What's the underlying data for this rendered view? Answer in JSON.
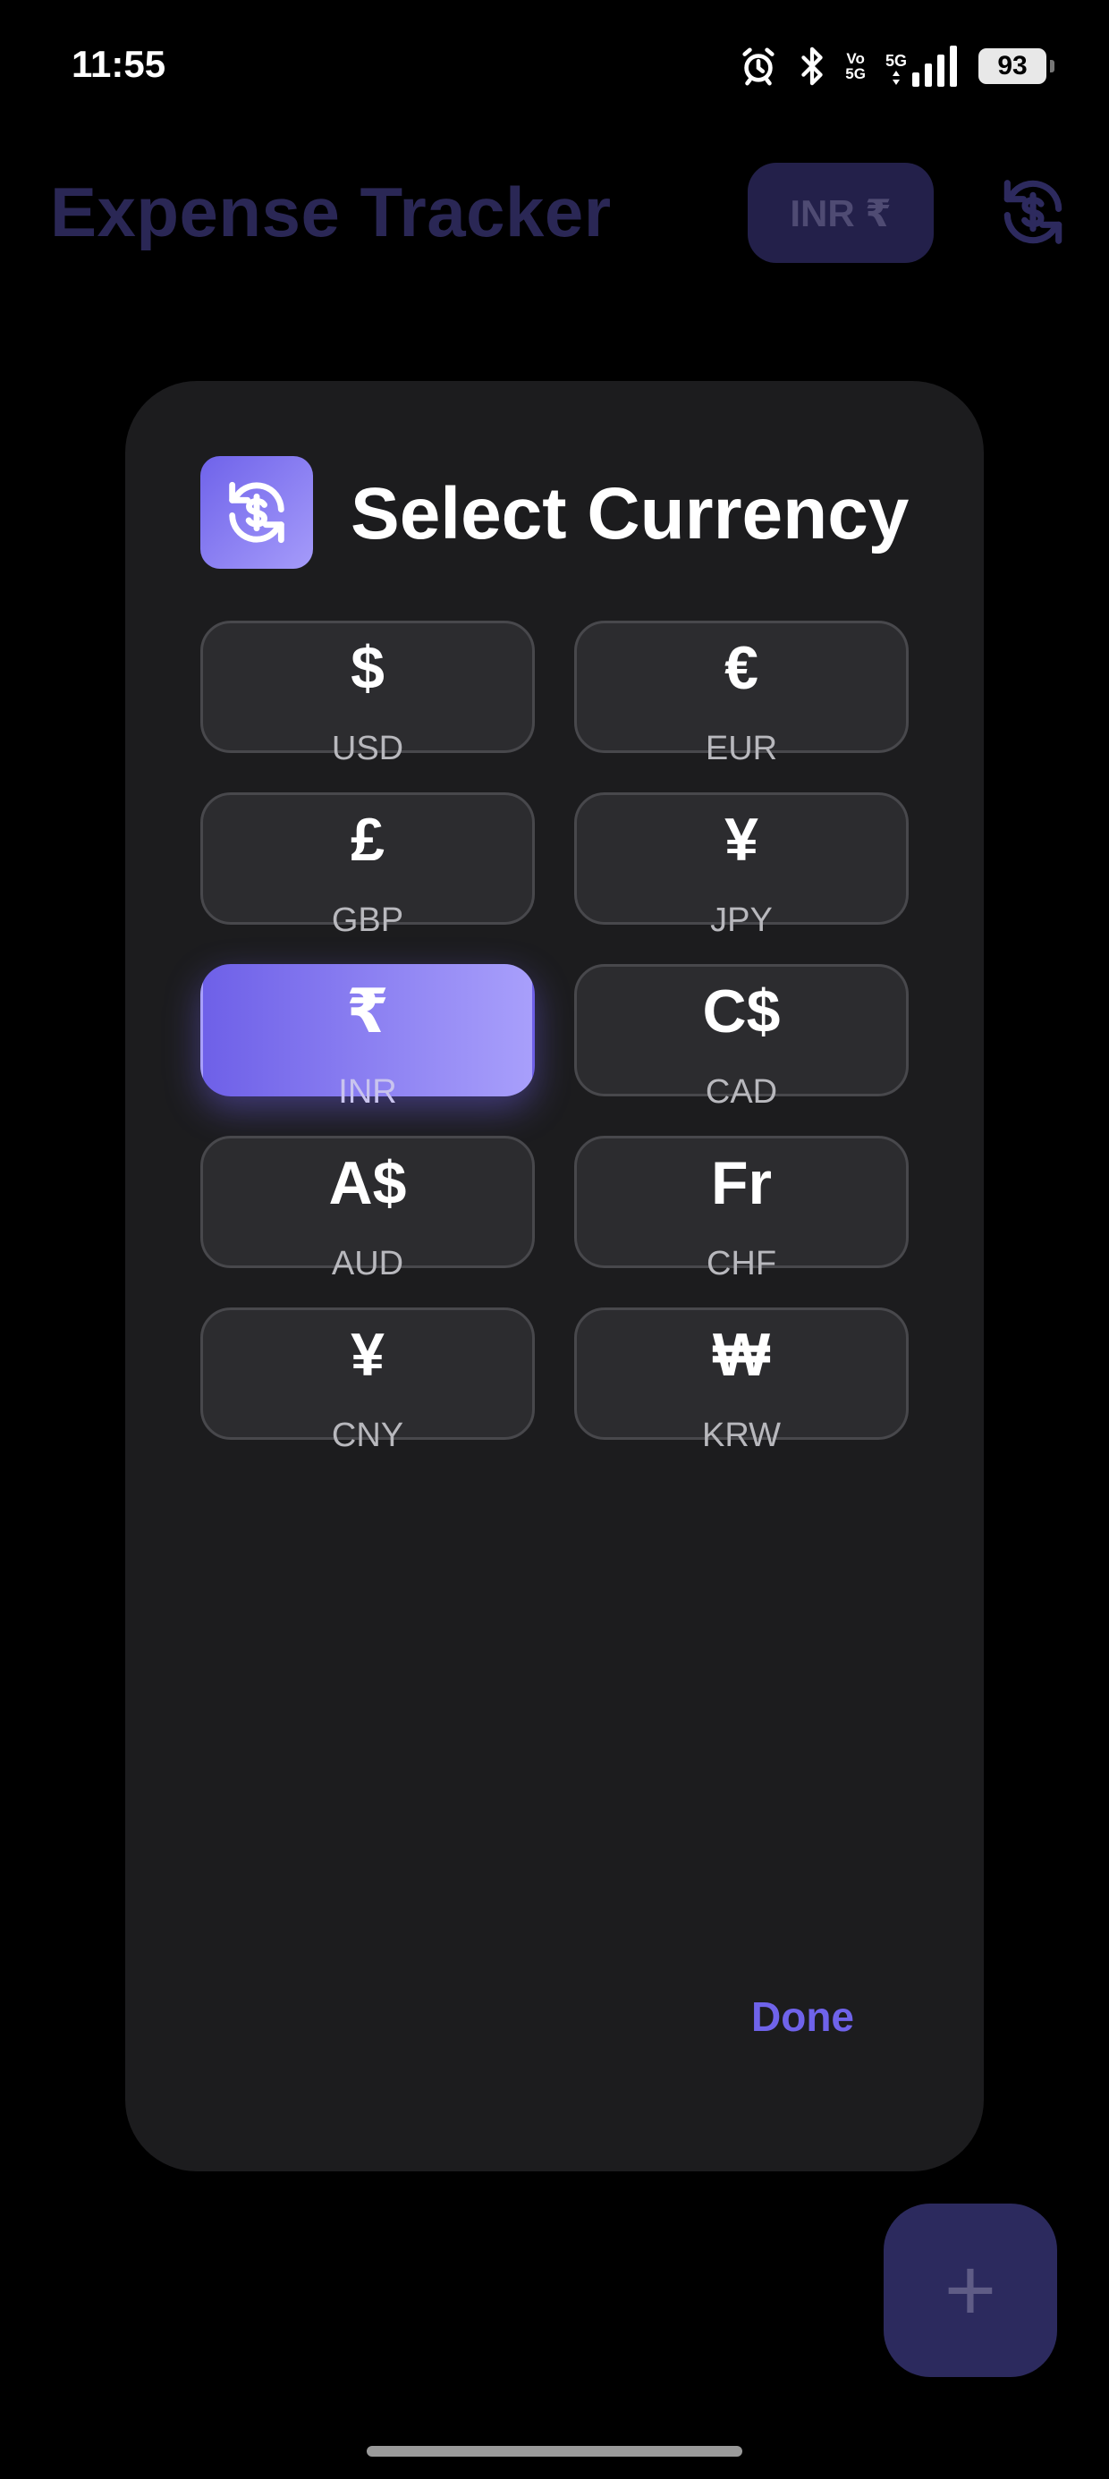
{
  "status_bar": {
    "time": "11:55",
    "network_label_top": "Vo",
    "network_label_bottom": "5G",
    "network_type": "5G",
    "battery": "93",
    "icons": [
      "alarm-icon",
      "bluetooth-icon",
      "volte-icon",
      "signal-icon",
      "battery-icon"
    ]
  },
  "app": {
    "title": "Expense Tracker",
    "currency_chip": "INR ₹",
    "exchange_icon": "currency-exchange-icon"
  },
  "modal": {
    "title": "Select Currency",
    "icon": "currency-exchange-icon",
    "selected": "INR",
    "currencies": [
      {
        "symbol": "$",
        "code": "USD"
      },
      {
        "symbol": "€",
        "code": "EUR"
      },
      {
        "symbol": "£",
        "code": "GBP"
      },
      {
        "symbol": "¥",
        "code": "JPY"
      },
      {
        "symbol": "₹",
        "code": "INR"
      },
      {
        "symbol": "C$",
        "code": "CAD"
      },
      {
        "symbol": "A$",
        "code": "AUD"
      },
      {
        "symbol": "Fr",
        "code": "CHF"
      },
      {
        "symbol": "¥",
        "code": "CNY"
      },
      {
        "symbol": "₩",
        "code": "KRW"
      }
    ],
    "done_label": "Done"
  },
  "fab": {
    "icon": "plus-icon",
    "label": "+"
  },
  "colors": {
    "accent": "#6f63ea",
    "accent_light": "#a59bfa",
    "modal_bg": "#1c1c1e",
    "cell_bg": "#2c2c2f"
  }
}
